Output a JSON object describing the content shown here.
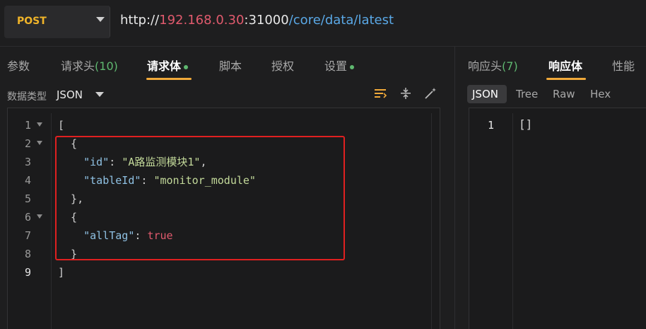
{
  "request": {
    "method": "POST",
    "url": {
      "protocol": "http://",
      "host": "192.168.0.30",
      "port": ":31000",
      "path": "/core/data/latest"
    }
  },
  "left_tabs": [
    {
      "label": "参数",
      "count": ""
    },
    {
      "label": "请求头",
      "count": "(10)"
    },
    {
      "label": "请求体",
      "count": "",
      "active": true,
      "dot": true
    },
    {
      "label": "脚本",
      "count": ""
    },
    {
      "label": "授权",
      "count": ""
    },
    {
      "label": "设置",
      "count": "",
      "dot": true
    }
  ],
  "right_tabs": [
    {
      "label": "响应头",
      "count": "(7)"
    },
    {
      "label": "响应体",
      "count": "",
      "active": true
    },
    {
      "label": "性能",
      "count": ""
    }
  ],
  "body_toolbar": {
    "data_type_label": "数据类型",
    "data_type_value": "JSON",
    "icons": [
      "format-icon",
      "wrap-icon",
      "magic-wand-icon"
    ]
  },
  "request_body": {
    "line_numbers": [
      "1",
      "2",
      "3",
      "4",
      "5",
      "6",
      "7",
      "8",
      "9"
    ],
    "lines": {
      "l1": "[",
      "l2": "  {",
      "l3_key": "\"id\"",
      "l3_colon": ": ",
      "l3_val": "\"A路监测模块1\"",
      "l3_end": ",",
      "l4_key": "\"tableId\"",
      "l4_colon": ": ",
      "l4_val": "\"monitor_module\"",
      "l5": "  },",
      "l6": "  {",
      "l7_key": "\"allTag\"",
      "l7_colon": ": ",
      "l7_val": "true",
      "l8": "  }",
      "l9": "]"
    }
  },
  "response_view": {
    "tabs": [
      "JSON",
      "Tree",
      "Raw",
      "Hex"
    ],
    "active_tab": "JSON",
    "line_number": "1",
    "body": "[]"
  },
  "colors": {
    "accent": "#f0a93a",
    "method": "#f0b429",
    "host": "#e05a6d",
    "path": "#5aa8e6",
    "json_key": "#8fc1e3",
    "json_string": "#c3d99a",
    "json_bool": "#e05a6d",
    "annotation_box": "#e02020"
  }
}
